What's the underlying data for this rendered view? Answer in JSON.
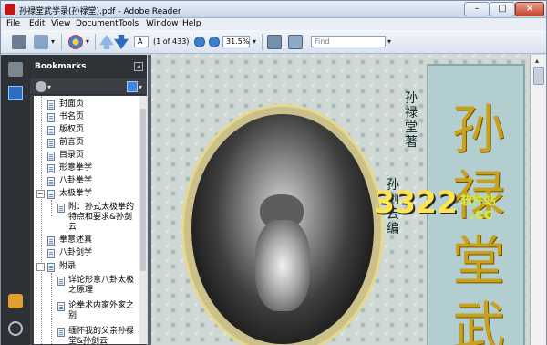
{
  "window": {
    "title": "孙禄堂武学录(孙禄堂).pdf - Adobe Reader"
  },
  "menu": [
    "File",
    "Edit",
    "View",
    "Document",
    "Tools",
    "Window",
    "Help"
  ],
  "toolbar": {
    "page_current": "A",
    "page_total": "(1 of 433)",
    "zoom": "31.5%",
    "find_placeholder": "Find"
  },
  "bookmarks": {
    "title": "Bookmarks",
    "items": [
      {
        "label": "封面页"
      },
      {
        "label": "书名页"
      },
      {
        "label": "版权页"
      },
      {
        "label": "前言页"
      },
      {
        "label": "目录页"
      },
      {
        "label": "形意拳学"
      },
      {
        "label": "八卦拳学"
      },
      {
        "label": "太极拳学"
      },
      {
        "label": "附：孙式太极拳的特点和要求&孙剑云"
      },
      {
        "label": "拳意述真"
      },
      {
        "label": "八卦剑学"
      },
      {
        "label": "附录"
      },
      {
        "label": "详论形意八卦太极之原理"
      },
      {
        "label": "论拳术内家外家之别"
      },
      {
        "label": "缅怀我的父亲孙禄堂&孙剑云"
      }
    ]
  },
  "document": {
    "author_line1": "孙禄堂 著",
    "author_line2": "孙剑云 编",
    "book_title": "孙禄堂武",
    "watermark_number": "3322",
    "watermark_brand": "软件站",
    "watermark_domain": ".cc"
  },
  "colors": {
    "title_gold": "#c8a21e",
    "sidebar_dark": "#3b3f44"
  }
}
